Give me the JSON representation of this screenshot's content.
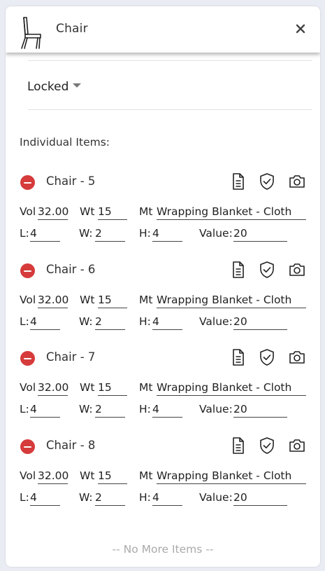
{
  "header": {
    "title": "Chair",
    "icon": "chair-icon",
    "close_icon": "close-icon"
  },
  "status": {
    "selected": "Locked",
    "caret_icon": "caret-down-icon"
  },
  "items_section_label": "Individual Items:",
  "field_labels": {
    "vol": "Vol",
    "wt": "Wt",
    "mt": "Mt",
    "l": "L:",
    "w": "W:",
    "h": "H:",
    "value": "Value:"
  },
  "items": [
    {
      "name": "Chair - 5",
      "vol": "32.00",
      "wt": "15",
      "mt": "Wrapping Blanket - Cloth",
      "l": "4",
      "w": "2",
      "h": "4",
      "value": "20"
    },
    {
      "name": "Chair - 6",
      "vol": "32.00",
      "wt": "15",
      "mt": "Wrapping Blanket - Cloth",
      "l": "4",
      "w": "2",
      "h": "4",
      "value": "20"
    },
    {
      "name": "Chair - 7",
      "vol": "32.00",
      "wt": "15",
      "mt": "Wrapping Blanket - Cloth",
      "l": "4",
      "w": "2",
      "h": "4",
      "value": "20"
    },
    {
      "name": "Chair - 8",
      "vol": "32.00",
      "wt": "15",
      "mt": "Wrapping Blanket - Cloth",
      "l": "4",
      "w": "2",
      "h": "4",
      "value": "20"
    }
  ],
  "item_action_icons": [
    "document-icon",
    "shield-check-icon",
    "camera-icon"
  ],
  "footer_text": "-- No More Items --",
  "colors": {
    "remove": "#d63b3b",
    "footer_text": "#aaaaaa"
  }
}
